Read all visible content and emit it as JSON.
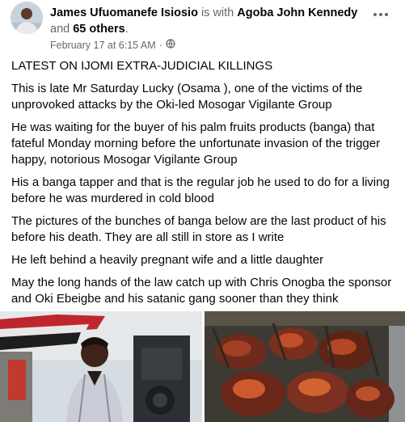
{
  "post": {
    "author": "James Ufuomanefe Isiosio",
    "with_text": "is with",
    "tagged": "Agoba John Kennedy",
    "and_text": "and",
    "others": "65 others",
    "period": ".",
    "date": "February 17 at 6:15 AM",
    "separator": "·",
    "privacy_icon": "globe-icon"
  },
  "body": {
    "paragraphs": [
      "LATEST ON IJOMI EXTRA-JUDICIAL KILLINGS",
      "This is late Mr Saturday Lucky (Osama ), one of the victims of the unprovoked attacks by the Oki-led Mosogar Vigilante Group",
      "He was waiting for the buyer of his palm fruits products (banga) that fateful Monday morning before the unfortunate invasion of the trigger happy, notorious Mosogar Vigilante Group",
      "His a banga tapper and that is the regular job he used to do for a living before he was murdered in cold blood",
      "The pictures of the bunches of banga below are the last product of his before his death. They are all still in store as I write",
      "He left behind a heavily pregnant wife and a little daughter",
      "May the long hands of the law catch up with Chris Onogba the sponsor and Oki Ebeigbe and his satanic gang sooner than they think"
    ]
  },
  "colors": {
    "text": "#050505",
    "secondary": "#65676b"
  }
}
